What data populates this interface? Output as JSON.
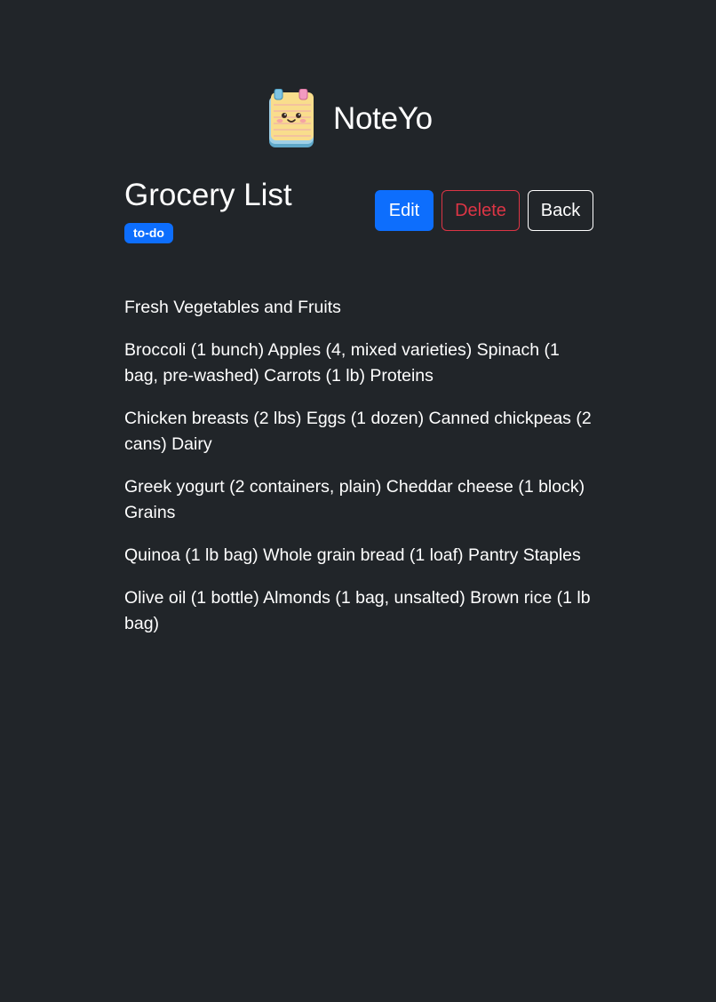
{
  "app": {
    "name": "NoteYo",
    "logo_icon": "notepad-mascot-icon"
  },
  "note": {
    "title": "Grocery List",
    "tag": "to-do",
    "paragraphs": [
      "Fresh Vegetables and Fruits",
      "Broccoli (1 bunch) Apples (4, mixed varieties) Spinach (1 bag, pre-washed) Carrots (1 lb) Proteins",
      "Chicken breasts (2 lbs) Eggs (1 dozen) Canned chickpeas (2 cans) Dairy",
      "Greek yogurt (2 containers, plain) Cheddar cheese (1 block) Grains",
      "Quinoa (1 lb bag) Whole grain bread (1 loaf) Pantry Staples",
      "Olive oil (1 bottle) Almonds (1 bag, unsalted) Brown rice (1 lb bag)"
    ]
  },
  "actions": {
    "edit_label": "Edit",
    "delete_label": "Delete",
    "back_label": "Back"
  },
  "colors": {
    "background": "#212529",
    "primary": "#0d6efd",
    "danger": "#dc3545",
    "text": "#ffffff"
  }
}
